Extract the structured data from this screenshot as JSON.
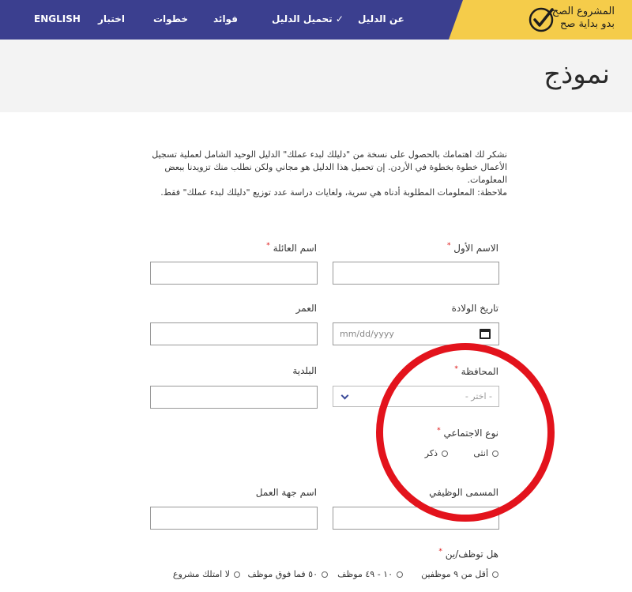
{
  "header": {
    "brand_line1": "المشروع الصح",
    "brand_line2": "بدو بداية صح",
    "nav": [
      {
        "label": "عن الدليل"
      },
      {
        "label": "تحميل الدليل",
        "check": "✓"
      },
      {
        "label": "فوائد"
      },
      {
        "label": "خطوات"
      },
      {
        "label": "اختبار"
      },
      {
        "label": "ENGLISH"
      }
    ]
  },
  "title": "نموذج",
  "intro": {
    "line1": "نشكر لك اهتمامك بالحصول على نسخة من \"دليلك لبدء عملك\" الدليل الوحيد الشامل لعملية تسجيل الأعمال خطوة بخطوة في الأردن. إن تحميل هذا الدليل هو مجاني ولكن نطلب منك تزويدنا ببعض المعلومات.",
    "line2": "ملاحظة: المعلومات المطلوبة أدناه هي سرية، ولغايات دراسة عدد توزيع \"دليلك لبدء عملك\" فقط."
  },
  "form": {
    "required_mark": "*",
    "first_name_label": "الاسم الأول",
    "last_name_label": "اسم العائلة",
    "dob_label": "تاريخ الولادة",
    "dob_placeholder": "mm/dd/yyyy",
    "age_label": "العمر",
    "governorate_label": "المحافظة",
    "governorate_value": "- اختر -",
    "municipality_label": "البلدية",
    "gender_label": "نوع الاجتماعي",
    "gender_options": [
      "انثى",
      "ذكر"
    ],
    "job_title_label": "المسمى الوظيفي",
    "employer_label": "اسم جهة العمل",
    "employees_label": "هل توظف/ين",
    "employees_options": [
      "أقل من ٩ موظفين",
      "١٠ - ٤٩ موظف",
      "٥٠ فما فوق موظف",
      "لا امتلك مشروع"
    ]
  },
  "colors": {
    "nav_bg": "#3b3f8f",
    "brand_bg": "#f5cc4a",
    "title_strip_bg": "#f3f3f3",
    "required": "#dd1111",
    "annotation_circle": "#e3131c"
  }
}
